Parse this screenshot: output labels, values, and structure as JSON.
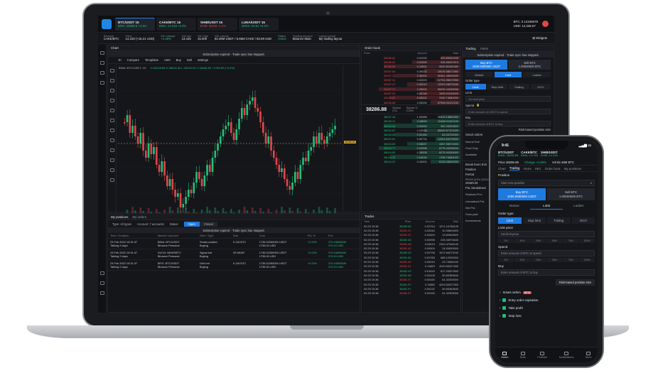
{
  "laptop": {
    "tickers": [
      {
        "pair": "BTC/USDT",
        "badge": "15",
        "exchange": "BINA",
        "price": "38286.8",
        "change": "+4.4%"
      },
      {
        "pair": "CAKE/BTC",
        "badge": "15",
        "exchange": "BINA",
        "price": "14.318",
        "change": "+4.3%"
      },
      {
        "pair": "SHIB/USDT",
        "badge": "15",
        "exchange": "BYBI",
        "price": "30219",
        "change": "-1.1%"
      },
      {
        "pair": "LUNA/USDT",
        "badge": "15",
        "exchange": "OKEX",
        "price": "53.51",
        "change": "+6.2%"
      }
    ],
    "account": {
      "btc": "BTC: 0.12345678",
      "usd": "USD: 12,345.67"
    },
    "info": [
      {
        "k": "Binance",
        "v": "CAKE/BTC"
      },
      {
        "k": "Price",
        "v": "14.318 (+16.21 USD)"
      },
      {
        "k": "24h change",
        "v": "+4.48%"
      },
      {
        "k": "24h low",
        "v": "13.445"
      },
      {
        "k": "24h high",
        "v": "15.000"
      },
      {
        "k": "24h volume",
        "v": "82.49M USDT / 5.65M CAKE / 82.69 USD"
      },
      {
        "k": "Status",
        "v": "Active"
      },
      {
        "k": "Trading account",
        "v": "Binance Main"
      },
      {
        "k": "Layout preset",
        "v": "My trading layout"
      }
    ],
    "widgets_label": "Widgets",
    "chart": {
      "title": "Chart",
      "banner": "Subscription expired · Trade sync has stopped.",
      "toolbar": [
        "1h",
        "Compare",
        "Templates",
        "Alert",
        "Buy",
        "Sell",
        "Settings"
      ],
      "legend": "BINA: BTC/USDT, 1D",
      "ohlc": "O:33248.68 H:38516.32 L:33016.20 C:38286.80 +1763.69 (+5.4%)",
      "price_tag": "38286.80"
    },
    "positions": {
      "tabs": [
        "My positions",
        "My orders"
      ],
      "filters": {
        "type": "Type: All types",
        "account": "Account: 7 accounts",
        "status": "Status"
      },
      "status_seg": [
        "Open",
        "Closed"
      ],
      "banner": "Subscription expired · Trade sync has stopped.",
      "columns": [
        "Time / Duration",
        "Market / Account",
        "Side / Type",
        "Size",
        "Cost",
        "Pnl, %",
        "PnL"
      ],
      "rows": [
        {
          "time": "23 Feb 2022 19:31:37",
          "dur": "Talking 2 days",
          "market": "BINA: BTC/USDT",
          "account": "Binance Personal",
          "side": "Smart position",
          "type": "Buying",
          "size": "0.116 BTC",
          "cost": "1735.02260000 USDT",
          "cost2": "1735.00 USD",
          "pnlp": "+0.23%",
          "pnl": "379.24890808",
          "pnl2": "379.24 USD"
        },
        {
          "time": "23 Feb 2022 19:31:37",
          "dur": "Talking 2 days",
          "market": "KUCN: NEAR/BTC",
          "account": "Binance Personal",
          "side": "Signal bot",
          "type": "Buying",
          "size": "25 NEAR",
          "cost": "1735.02260000 USDT",
          "cost2": "1735.00 USD",
          "pnlp": "+0.23%",
          "pnl": "379.24890808",
          "pnl2": "379.24 USD"
        },
        {
          "time": "23 Feb 2022 19:31:37",
          "dur": "Talking 2 days",
          "market": "BFIX: BTC/USDT",
          "account": "Binance Personal",
          "side": "Grid bot",
          "type": "Buying",
          "size": "0.116 BTC",
          "cost": "1735.02260000 USDT",
          "cost2": "1735.00 USD",
          "pnlp": "+0.23%",
          "pnl": "379.24890808",
          "pnl2": "379.24 USD"
        }
      ]
    },
    "orderbook": {
      "title": "Order book",
      "cols": [
        "Price",
        "Amount",
        "Total"
      ],
      "asks": [
        [
          "38288.82",
          "0.01290",
          "493.83942948"
        ],
        [
          "38288.82",
          "0.02596",
          "993.96097874"
        ],
        [
          "38288.80",
          "0.13061",
          "5000.80281980"
        ],
        [
          "38287.83",
          "0.39220",
          "15016.58671984"
        ],
        [
          "38287.32",
          "2.36000",
          "90361.48000000"
        ],
        [
          "38287.31",
          "0.32029",
          "12731.95672950"
        ],
        [
          "38287.22",
          "0.30012",
          "10003.08675346"
        ],
        [
          "38287.21",
          "2.35000",
          "90033.44098998"
        ],
        [
          "38287.00",
          "0.09148",
          "3499.01616000"
        ],
        [
          "38286.89",
          "0.08331",
          "3159.73680090"
        ],
        [
          "38286.86",
          "2.28339",
          "87508.06122230"
        ]
      ],
      "mid": {
        "price": "38286.88",
        "spread_label": "Spread",
        "spread": "0.01",
        "pct_label": "Spread %",
        "pct": "0.00%"
      },
      "bids": [
        [
          "38037.43",
          "1.00988",
          "38413.13661050"
        ],
        [
          "38035.21",
          "0.28849",
          "11008.01322190"
        ],
        [
          "38018.56",
          "0.00926",
          "352.34003500"
        ],
        [
          "38022.87",
          "2.22948",
          "85649.57121000"
        ],
        [
          "38028.55",
          "0.00166",
          "63.33702000"
        ],
        [
          "38022.81",
          "0.50734",
          "12603.60076000"
        ],
        [
          "38024.60",
          "0.08637",
          "3367.98074300"
        ],
        [
          "38024.77",
          "0.22996",
          "8775.43335000"
        ],
        [
          "38024.50",
          "0.16208",
          "6275.94159000"
        ],
        [
          "38024.33",
          "0.04045",
          "1798.74684000"
        ],
        [
          "38024.02",
          "0.16000",
          "6103.28000000"
        ]
      ]
    },
    "trades": {
      "title": "Trades",
      "cols": [
        "Time",
        "Price",
        "Amount",
        "Total"
      ],
      "rows": [
        [
          "02:25 10:36",
          "38283.58",
          "0.02764",
          "1071.10738128",
          "bid"
        ],
        [
          "02:25 10:36",
          "38281.97",
          "0.02040",
          "10.39620000",
          "ask"
        ],
        [
          "02:25 10:36",
          "38281.97",
          "0.03494",
          "13.80904520",
          "ask"
        ],
        [
          "02:25 10:36",
          "38282.46",
          "0.00098",
          "225.34974640",
          "bid"
        ],
        [
          "02:25 10:36",
          "38281.98",
          "0.06113",
          "2343.47945140",
          "ask"
        ],
        [
          "02:25 10:36",
          "38281.80",
          "0.00004",
          "24.53020000",
          "ask"
        ],
        [
          "02:25 10:36",
          "38280.28",
          "0.02798",
          "1072.64073240",
          "bid"
        ],
        [
          "02:25 10:36",
          "38281.50",
          "0.02785",
          "665.12925000",
          "bid"
        ],
        [
          "02:25 10:36",
          "38281.98",
          "0.00019",
          "23.73984240",
          "ask"
        ],
        [
          "02:25 10:36",
          "38281.91",
          "0.11883",
          "4249.54227450",
          "ask"
        ],
        [
          "02:25 10:36",
          "38282.43",
          "0.01610",
          "617.20927600",
          "bid"
        ],
        [
          "02:25 10:36",
          "38281.98",
          "0.00105",
          "50.60383640",
          "bid"
        ],
        [
          "02:25 10:36",
          "38281.97",
          "0.00160",
          "61.32303000",
          "ask"
        ],
        [
          "02:25 10:36",
          "38281.97",
          "0.11883",
          "4249.54227300",
          "bid"
        ],
        [
          "02:25 10:36",
          "38281.97",
          "0.00132",
          "50.60383640",
          "bid"
        ],
        [
          "02:25 10:36",
          "38281.97",
          "0.00160",
          "61.32303000",
          "ask"
        ]
      ]
    },
    "trading": {
      "tabs": [
        "Trading",
        "Alerts"
      ],
      "banner": "Subscription expired · Trade sync has stopped.",
      "buy": {
        "label": "Buy BTC",
        "sub": "1000.0000000 USDT"
      },
      "sell": {
        "label": "Sell BTC",
        "sub": "1.00000000 BTC"
      },
      "modes": [
        "Market",
        "Limit",
        "Ladder"
      ],
      "order_type_label": "Order type",
      "order_types": [
        "Limit",
        "Stop limit",
        "Trailing",
        "OCO"
      ],
      "limit_label": "Limit",
      "limit_placeholder": "Set limit price",
      "spend_label": "Spend",
      "spend_placeholder": "Enter amount of USDT to spend",
      "buy_label": "Buy",
      "buy_placeholder": "Enter amount of BTC to buy",
      "risk": "Risk-based position size",
      "smart_orders": "Smart orders",
      "side_labels": [
        "Neural Exit",
        "Prod Only",
        "Available"
      ],
      "break_even": "Break Even Exit",
      "position_label": "Position",
      "period_label": "Period",
      "reset_price": "Reset price proce",
      "reset_value": "26459.25",
      "pnl_breakdown": "PnL breakdown",
      "pnl_rows": [
        "Realized PnL",
        "Unrealized PnL",
        "Net PnL",
        "Fees paid",
        "Investments"
      ]
    }
  },
  "phone": {
    "time": "9:41",
    "tickers": [
      {
        "pair": "BTC/USDT",
        "exchange": "BINA",
        "price": "38286.88"
      },
      {
        "pair": "CAKE/BTC",
        "exchange": "BINA",
        "price": "14.318"
      },
      {
        "pair": "SHIB/USDT",
        "exchange": "BYBI",
        "price": "14.318"
      }
    ],
    "price_row": {
      "price": "Price 38286.88",
      "change": "Change +4.88%",
      "vol": "Vol 82.49M BTC"
    },
    "nav": [
      "Chart",
      "Trading",
      "Alerts",
      "SEC",
      "Order book",
      "My positions"
    ],
    "position_label": "Position",
    "start_position": "Start new position",
    "buy": {
      "label": "Buy BTC",
      "sub": "1000.0000000 USDT"
    },
    "sell": {
      "label": "Sell BTC",
      "sub": "1.00000000 BTC"
    },
    "modes": [
      "Market",
      "Limit",
      "Ladder"
    ],
    "order_type_label": "Order type",
    "order_types": [
      "Limit",
      "Stop limit",
      "Trailing",
      "OCO"
    ],
    "limit_label": "Limit price",
    "limit_placeholder": "Set limit price",
    "spend_label": "Spend",
    "spend_placeholder": "Enter amount of BTC to spend",
    "buy_label": "Buy",
    "buy_placeholder": "Enter amount of BTC to buy",
    "pcts": [
      "0%",
      "10%",
      "25%",
      "50%",
      "75%",
      "100%"
    ],
    "risk": "Risk-based position size",
    "smart_orders": "Smart orders",
    "smart_badge": "BETA",
    "smart_items": [
      "Entry order expiration",
      "Take profit",
      "Stop loss"
    ],
    "tabbar": [
      "Home",
      "Bots",
      "Portfolio",
      "Notifications",
      "More"
    ]
  },
  "colors": {
    "accent": "#1f7ae0",
    "up": "#21c07a",
    "down": "#e0464a",
    "bg": "#15161a"
  }
}
